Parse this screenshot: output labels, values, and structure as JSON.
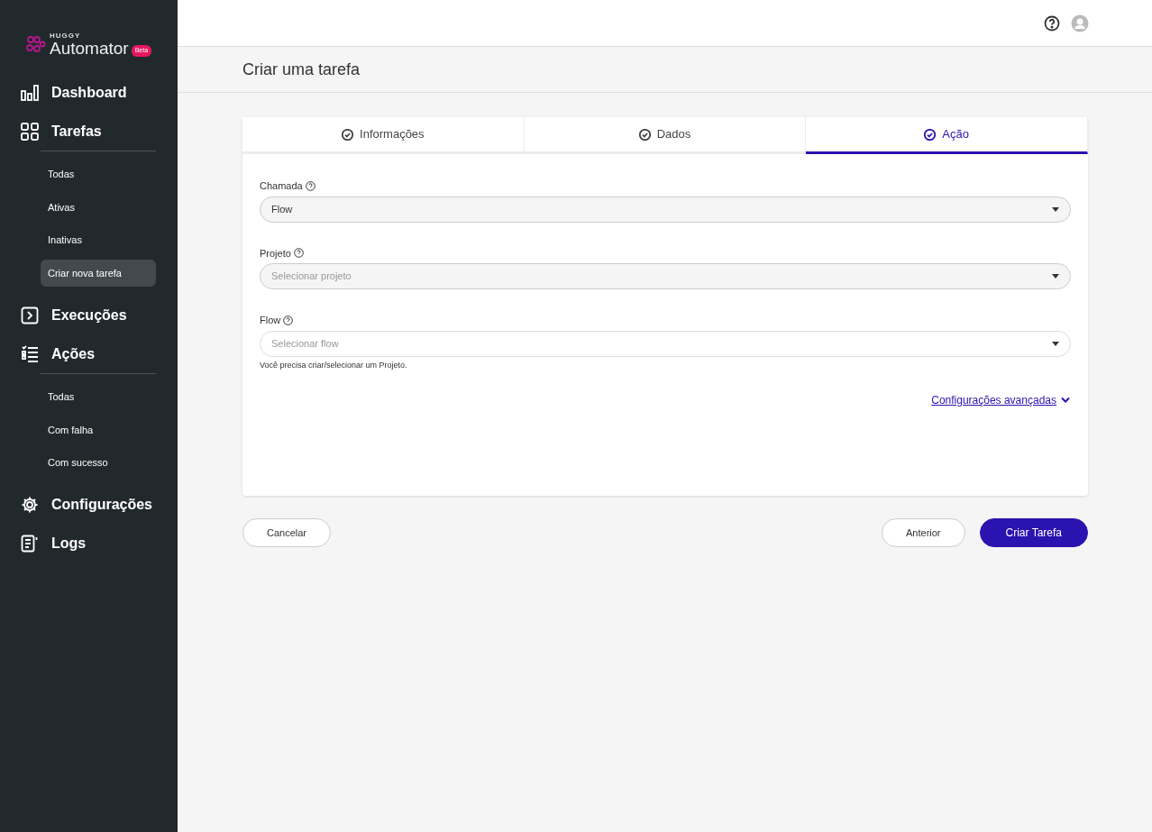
{
  "logo": {
    "brand": "HUGGY",
    "name": "Automator",
    "badge": "Beta"
  },
  "sidebar": {
    "sections": [
      {
        "label": "Dashboard"
      },
      {
        "label": "Tarefas",
        "children": [
          {
            "label": "Todas",
            "selected": false
          },
          {
            "label": "Ativas",
            "selected": false
          },
          {
            "label": "Inativas",
            "selected": false
          },
          {
            "label": "Criar nova tarefa",
            "selected": true
          }
        ]
      },
      {
        "label": "Execuções"
      },
      {
        "label": "Ações",
        "children": [
          {
            "label": "Todas",
            "selected": false
          },
          {
            "label": "Com falha",
            "selected": false
          },
          {
            "label": "Com sucesso",
            "selected": false
          }
        ]
      },
      {
        "label": "Configurações"
      },
      {
        "label": "Logs"
      }
    ]
  },
  "page_title": "Criar uma tarefa",
  "tabs": [
    {
      "label": "Informações",
      "selected": false
    },
    {
      "label": "Dados",
      "selected": false
    },
    {
      "label": "Ação",
      "selected": true
    }
  ],
  "fields": [
    {
      "label": "Chamada",
      "value": "Flow",
      "disabled": false
    },
    {
      "label": "Projeto",
      "placeholder": "Selecionar projeto",
      "disabled": false
    },
    {
      "label": "Flow",
      "placeholder": "Selecionar flow",
      "disabled": true,
      "hint": "Você precisa criar/selecionar um Projeto."
    }
  ],
  "advanced_link": "Configurações avançadas",
  "buttons": {
    "cancel": "Cancelar",
    "previous": "Anterior",
    "submit": "Criar Tarefa"
  }
}
